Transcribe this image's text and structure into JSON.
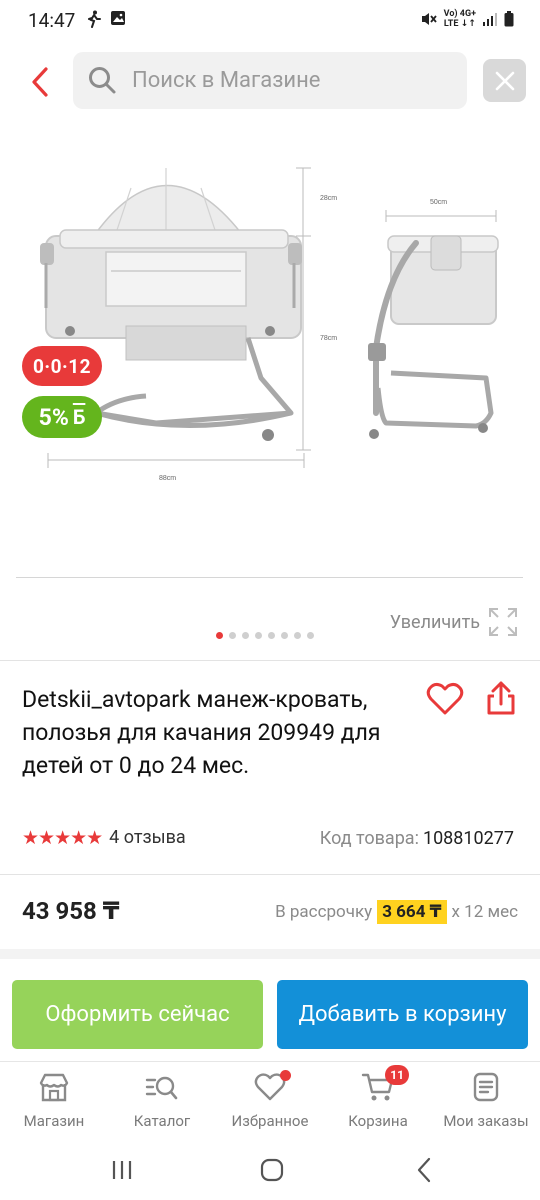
{
  "status_bar": {
    "time": "14:47",
    "network_top": "Vo) 4G+",
    "network_bottom": "LTE ↓↑"
  },
  "search": {
    "placeholder": "Поиск в Магазине"
  },
  "product": {
    "badge_age": "0·0·12",
    "badge_bonus_percent": "5%",
    "badge_bonus_currency": "Б",
    "zoom_label": "Увеличить",
    "image_count": 8,
    "active_image_index": 0,
    "title": "Detskii_avtopark манеж-кровать, полозья для качания 209949 для детей от 0 до 24 мес.",
    "rating_stars": 5,
    "reviews": "4 отзыва",
    "sku_label": "Код товара:",
    "sku_value": "108810277",
    "price": "43 958 ₸",
    "installment_prefix": "В рассрочку",
    "installment_amount": "3 664 ₸",
    "installment_suffix": "х 12 мес",
    "diagram_labels": {
      "height_top": "28cm",
      "height_bottom": "78cm",
      "width": "88cm",
      "depth": "50cm"
    }
  },
  "actions": {
    "checkout_label": "Оформить сейчас",
    "add_to_cart_label": "Добавить в корзину"
  },
  "bottom_nav": {
    "items": [
      {
        "label": "Магазин",
        "icon": "store-icon"
      },
      {
        "label": "Каталог",
        "icon": "catalog-search-icon"
      },
      {
        "label": "Избранное",
        "icon": "heart-icon"
      },
      {
        "label": "Корзина",
        "icon": "cart-icon",
        "badge": "11"
      },
      {
        "label": "Мои заказы",
        "icon": "orders-icon"
      }
    ]
  },
  "colors": {
    "accent_red": "#e83a3a",
    "checkout_green": "#96d35a",
    "cart_blue": "#1390d8",
    "bonus_green": "#64b51d",
    "installment_yellow": "#ffd21f"
  }
}
